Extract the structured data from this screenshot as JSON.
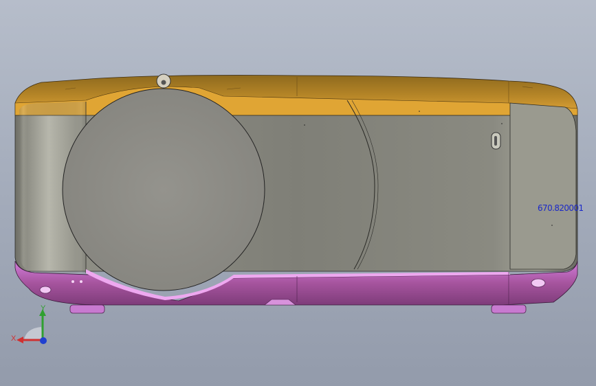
{
  "viewport": {
    "background_top": "#b6bdca",
    "background_bottom": "#939bab"
  },
  "model": {
    "name": "projector",
    "colors": {
      "top_shell": "#c79225",
      "body_gray": "#8a8a80",
      "bottom_shell": "#b060b8",
      "lens_cap": "#8c8b85"
    }
  },
  "dimension_text": "670.820001",
  "triad": {
    "x_label": "X",
    "y_label": "Y",
    "x_color": "#d03030",
    "y_color": "#30a030",
    "z_color": "#2040d0"
  }
}
